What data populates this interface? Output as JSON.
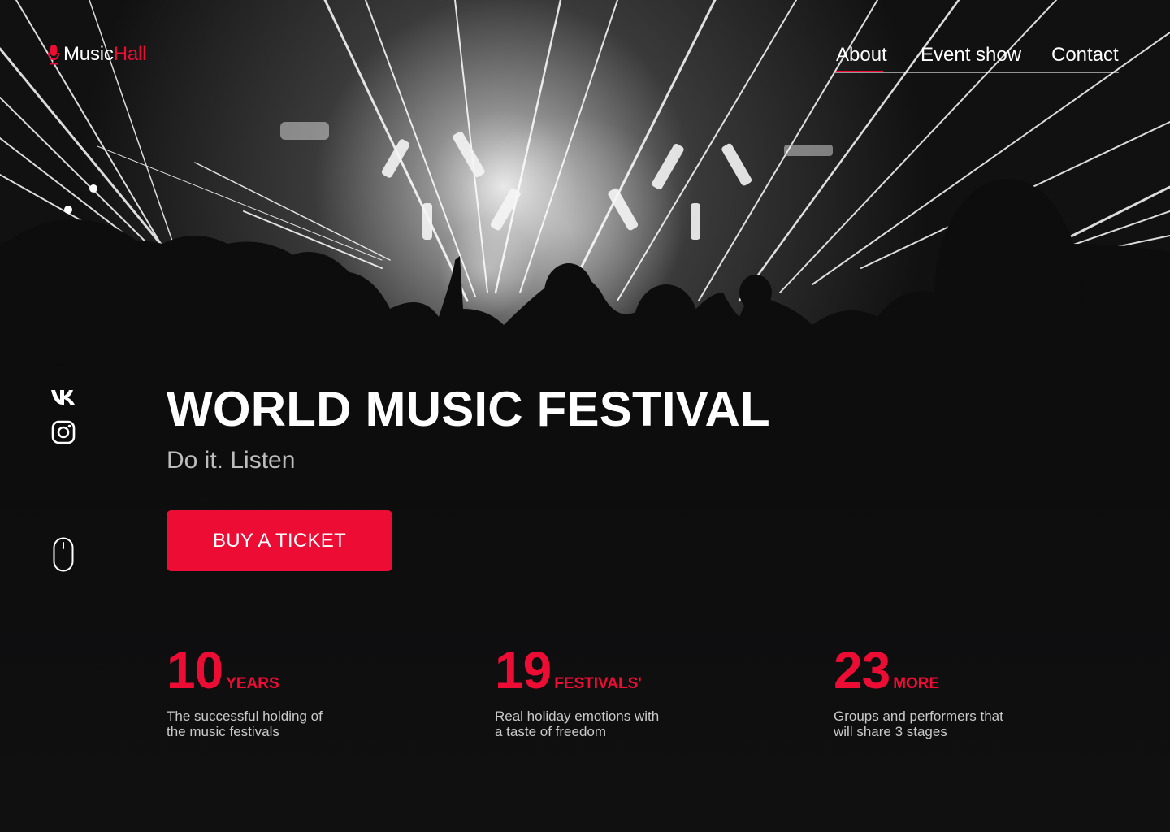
{
  "brand": {
    "name_part1": "Music",
    "name_part2": "Hall",
    "accent": "#ec0c34",
    "icon": "microphone-icon"
  },
  "nav": {
    "items": [
      {
        "label": "About",
        "active": true
      },
      {
        "label": "Event show"
      },
      {
        "label": "Contact"
      }
    ]
  },
  "social": {
    "icons": [
      "vk-icon",
      "instagram-icon",
      "mouse-scroll-icon"
    ]
  },
  "hero": {
    "title": "WORLD MUSIC FESTIVAL",
    "subtitle": "Do it. Listen",
    "cta_label": "BUY A TICKET"
  },
  "stats": [
    {
      "number": "10",
      "unit": "YEARS",
      "description": "The successful holding of\nthe music festivals"
    },
    {
      "number": "19",
      "unit": "FESTIVALS'",
      "description": "Real holiday emotions with\na taste of freedom"
    },
    {
      "number": "23",
      "unit": "MORE",
      "description": "Groups and performers that\nwill share 3 stages"
    }
  ],
  "colors": {
    "background": "#101011",
    "accent": "#ec0c34",
    "text": "#ffffff",
    "muted": "#bdbdbd"
  }
}
